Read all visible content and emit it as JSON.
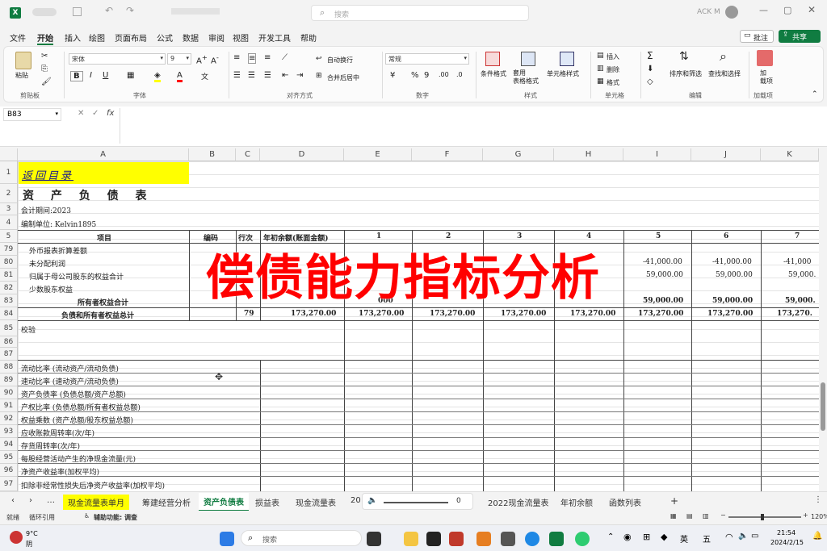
{
  "titlebar": {
    "search_placeholder": "搜索",
    "user": "ACK M"
  },
  "menu": [
    "文件",
    "开始",
    "插入",
    "绘图",
    "页面布局",
    "公式",
    "数据",
    "审阅",
    "视图",
    "开发工具",
    "帮助"
  ],
  "menu_right": {
    "comment": "批注",
    "share": "共享"
  },
  "ribbon": {
    "paste": "粘贴",
    "font_name": "宋体",
    "font_size": "9",
    "wrap": "自动换行",
    "merge": "合并后居中",
    "number_format": "常规",
    "cond_format": "条件格式",
    "table_format": "套用\n表格格式",
    "cell_style": "单元格样式",
    "insert": "插入",
    "delete": "删除",
    "format": "格式",
    "sort": "排序和筛选",
    "find": "查找和选择",
    "addin": "加\n载项",
    "groups": [
      "剪贴板",
      "字体",
      "对齐方式",
      "数字",
      "样式",
      "单元格",
      "编辑",
      "加载项"
    ]
  },
  "formula": {
    "namebox": "B83",
    "fx": "fx",
    "value": ""
  },
  "columns": [
    "A",
    "B",
    "C",
    "D",
    "E",
    "F",
    "G",
    "H",
    "I",
    "J",
    "K"
  ],
  "rows": {
    "r1": {
      "num": "1",
      "a": "返回目录"
    },
    "r2": {
      "num": "2",
      "a": "资 产 负 债 表"
    },
    "r3": {
      "num": "3",
      "a": "会计期间:2023"
    },
    "r4": {
      "num": "4",
      "a": "编制单位: Kelvin1895"
    },
    "r5": {
      "num": "5",
      "a": "项目",
      "b": "编码",
      "c": "行次",
      "d": "年初余额(账面金额)",
      "e": "1",
      "f": "2",
      "g": "3",
      "h": "4",
      "i": "5",
      "j": "6",
      "k": "7"
    },
    "r79": {
      "num": "79",
      "a": "外币报表折算差额"
    },
    "r80": {
      "num": "80",
      "a": "未分配利润",
      "i": "-41,000.00",
      "j": "-41,000.00",
      "k": "-41,000"
    },
    "r81": {
      "num": "81",
      "a": "归属于母公司股东的权益合计",
      "i": "59,000.00",
      "j": "59,000.00",
      "k": "59,000."
    },
    "r82": {
      "num": "82",
      "a": "少数股东权益"
    },
    "r83": {
      "num": "83",
      "a": "所有者权益合计",
      "e": "000",
      "i": "59,000.00",
      "j": "59,000.00",
      "k": "59,000."
    },
    "r84": {
      "num": "84",
      "a": "负债和所有者权益总计",
      "c": "79",
      "d": "173,270.00",
      "e": "173,270.00",
      "f": "173,270.00",
      "g": "173,270.00",
      "h": "173,270.00",
      "i": "173,270.00",
      "j": "173,270.00",
      "k": "173,270."
    },
    "r85": {
      "num": "85",
      "a": "校验"
    },
    "r86": {
      "num": "86",
      "a": ""
    },
    "r87": {
      "num": "87",
      "a": ""
    },
    "r88": {
      "num": "88",
      "a": "流动比率 (流动资产/流动负债)"
    },
    "r89": {
      "num": "89",
      "a": "速动比率 (速动资产/流动负债)"
    },
    "r90": {
      "num": "90",
      "a": "资产负债率 (负债总额/资产总额)"
    },
    "r91": {
      "num": "91",
      "a": "产权比率 (负债总额/所有者权益总额)"
    },
    "r92": {
      "num": "92",
      "a": "权益乘数 (资产总额/股东权益总额)"
    },
    "r93": {
      "num": "93",
      "a": "应收账款周转率(次/年)"
    },
    "r94": {
      "num": "94",
      "a": "存货周转率(次/年)"
    },
    "r95": {
      "num": "95",
      "a": "每股经营活动产生的净现金流量(元)"
    },
    "r96": {
      "num": "96",
      "a": "净资产收益率(加权平均)"
    },
    "r97": {
      "num": "97",
      "a": "扣除非经常性损失后净资产收益率(加权平均)"
    }
  },
  "overlay_text": "偿债能力指标分析",
  "sheets": [
    "现金流量表单月",
    "筹建经营分析",
    "资产负债表",
    "损益表",
    "现金流量表",
    "20",
    "2022现金流量表",
    "年初余额",
    "函数列表"
  ],
  "active_sheet": "资产负债表",
  "zoom_slider_value": "0",
  "status": {
    "ready": "就绪",
    "circular": "循环引用",
    "accessibility": "辅助功能: 调查",
    "zoom": "120%"
  },
  "taskbar": {
    "weather": "9°C",
    "weather_desc": "阴",
    "search": "搜索",
    "time": "21:54",
    "date": "2024/2/15",
    "lang": "英",
    "ime": "五"
  },
  "colors": {
    "excel_green": "#107c41",
    "highlight_yellow": "#ffff00",
    "overlay_red": "#ff0000",
    "sheet_tab_yellow": "#ffff00"
  }
}
